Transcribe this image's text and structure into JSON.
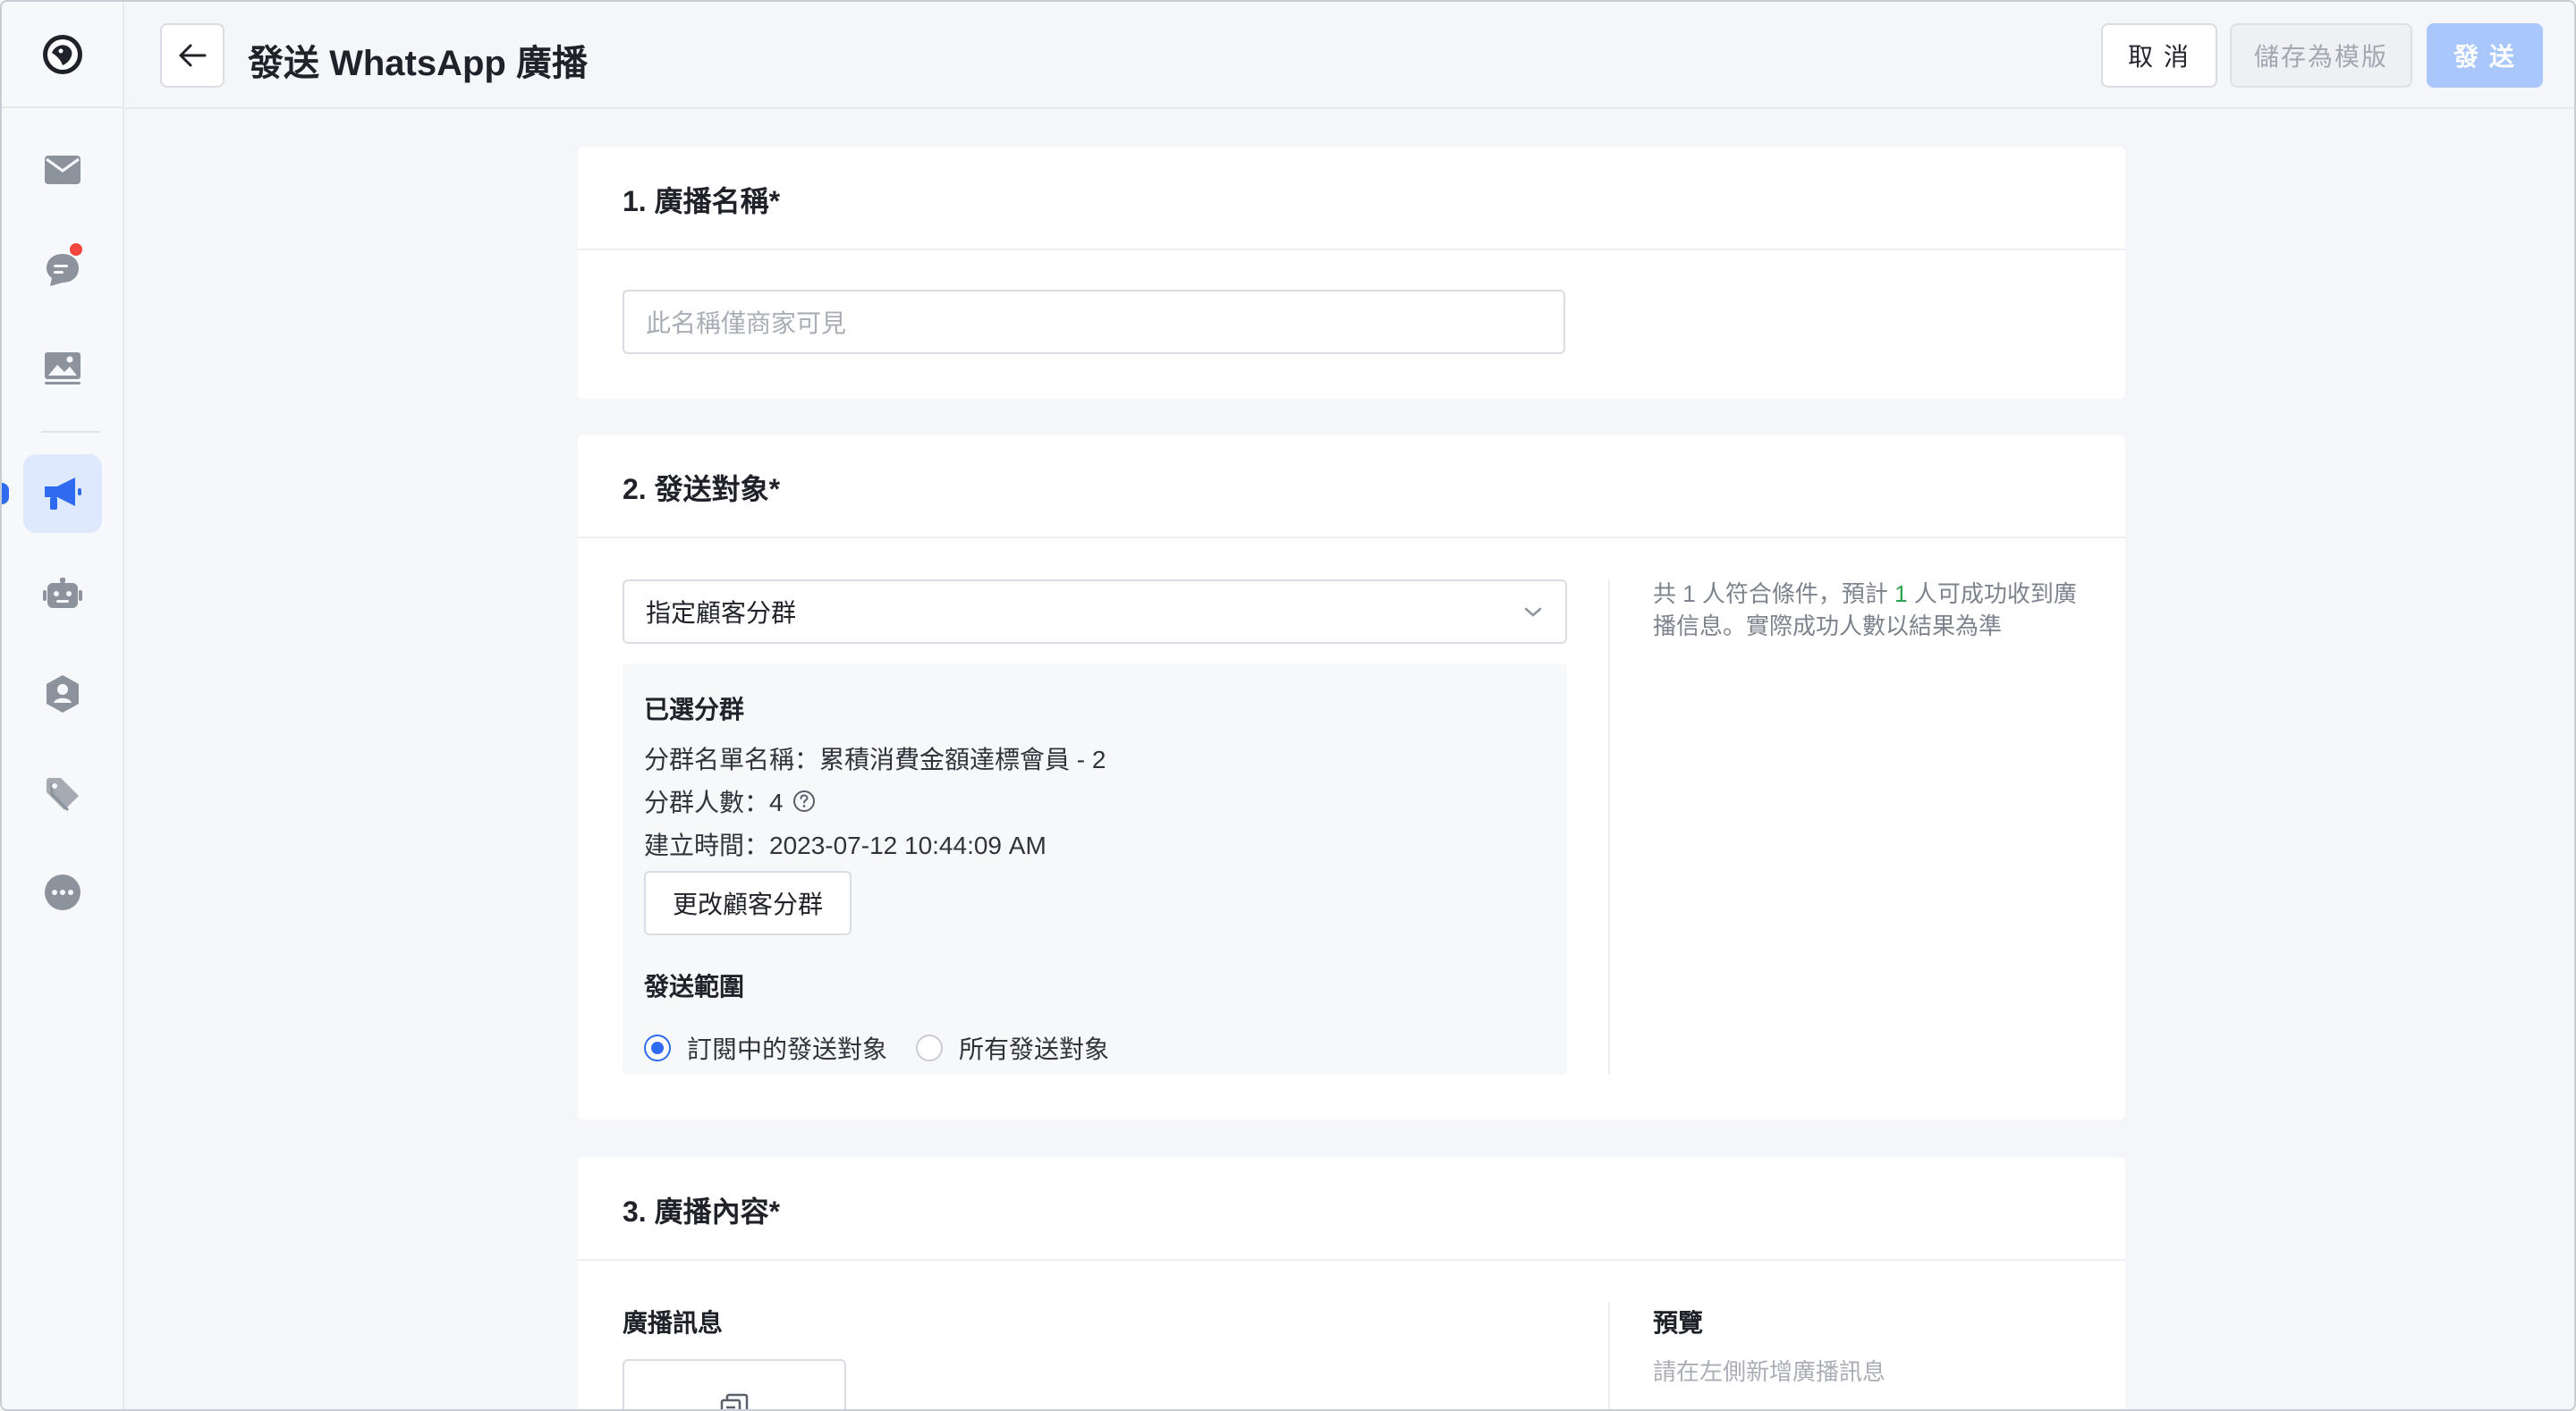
{
  "header": {
    "title": "發送 WhatsApp 廣播",
    "cancel_label": "取 消",
    "save_template_label": "儲存為模版",
    "send_label": "發 送"
  },
  "sidebar": {
    "items": [
      {
        "icon": "mail-icon"
      },
      {
        "icon": "chat-icon",
        "badge": true
      },
      {
        "icon": "image-icon"
      },
      {
        "icon": "megaphone-icon",
        "active": true
      },
      {
        "icon": "robot-icon"
      },
      {
        "icon": "user-shield-icon"
      },
      {
        "icon": "tag-icon"
      },
      {
        "icon": "more-icon"
      }
    ]
  },
  "section1": {
    "title": "1. 廣播名稱*",
    "name_placeholder": "此名稱僅商家可見",
    "name_value": ""
  },
  "section2": {
    "title": "2. 發送對象*",
    "target_select": "指定顧客分群",
    "selected_label": "已選分群",
    "segment_name": "分群名單名稱：累積消費金額達標會員 - 2",
    "segment_count": "分群人數：4",
    "segment_created": "建立時間：2023-07-12 10:44:09 AM",
    "change_button": "更改顧客分群",
    "scope_label": "發送範圍",
    "scope_options": [
      {
        "label": "訂閱中的發送對象",
        "checked": true
      },
      {
        "label": "所有發送對象",
        "checked": false
      }
    ],
    "summary_prefix": "共 1 人符合條件，預計 ",
    "summary_number": "1",
    "summary_suffix": " 人可成功收到廣播信息。實際成功人數以結果為準"
  },
  "section3": {
    "title": "3. 廣播內容*",
    "message_label": "廣播訊息",
    "preview_label": "預覽",
    "preview_empty": "請在左側新增廣播訊息"
  },
  "colors": {
    "primary": "#2e6bf0",
    "primary_disabled": "#a9c7fb",
    "badge": "#f0463c",
    "success": "#2ea44f"
  }
}
